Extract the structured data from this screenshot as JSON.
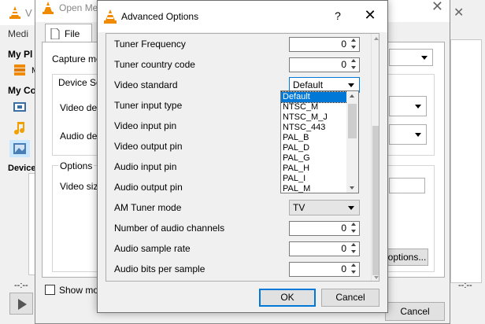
{
  "vlc_main": {
    "title_initial": "V",
    "menu_initial": "Medi",
    "headings": {
      "my_playlist": "My Pl",
      "my_computer": "My Co",
      "devices": "Device"
    },
    "mini_label": "M",
    "time_left": "--:--",
    "colors": {
      "cone": "#f08a00"
    }
  },
  "open_media": {
    "title": "Open Media",
    "tab_file": "File",
    "capture_mode_label": "Capture mo",
    "device_selection_label": "Device Sel",
    "video_device_label": "Video dev",
    "audio_device_label": "Audio dev",
    "options_label": "Options",
    "video_size_label": "Video size",
    "advanced_button": "options...",
    "show_more_label": "Show more",
    "cancel_button": "Cancel"
  },
  "right_strip": {
    "time": "--:--"
  },
  "advanced_options": {
    "title": "Advanced Options",
    "help_glyph": "?",
    "close_glyph": "✕",
    "rows": [
      {
        "label": "Tuner Frequency",
        "kind": "spin",
        "value": "0"
      },
      {
        "label": "Tuner country code",
        "kind": "spin",
        "value": "0"
      },
      {
        "label": "Video standard",
        "kind": "combo",
        "value": "Default",
        "open": true
      },
      {
        "label": "Tuner input type",
        "kind": "none"
      },
      {
        "label": "Video input pin",
        "kind": "none"
      },
      {
        "label": "Video output pin",
        "kind": "none"
      },
      {
        "label": "Audio input pin",
        "kind": "none"
      },
      {
        "label": "Audio output pin",
        "kind": "none"
      },
      {
        "label": "AM Tuner mode",
        "kind": "combo",
        "value": "TV"
      },
      {
        "label": "Number of audio channels",
        "kind": "spin",
        "value": "0"
      },
      {
        "label": "Audio sample rate",
        "kind": "spin",
        "value": "0"
      },
      {
        "label": "Audio bits per sample",
        "kind": "spin",
        "value": "0"
      }
    ],
    "video_standard_options": [
      "Default",
      "NTSC_M",
      "NTSC_M_J",
      "NTSC_443",
      "PAL_B",
      "PAL_D",
      "PAL_G",
      "PAL_H",
      "PAL_I",
      "PAL_M"
    ],
    "video_standard_selected": "Default",
    "ok_button": "OK",
    "cancel_button": "Cancel",
    "colors": {
      "selection": "#0078d7",
      "focus_border": "#0078d7"
    }
  }
}
